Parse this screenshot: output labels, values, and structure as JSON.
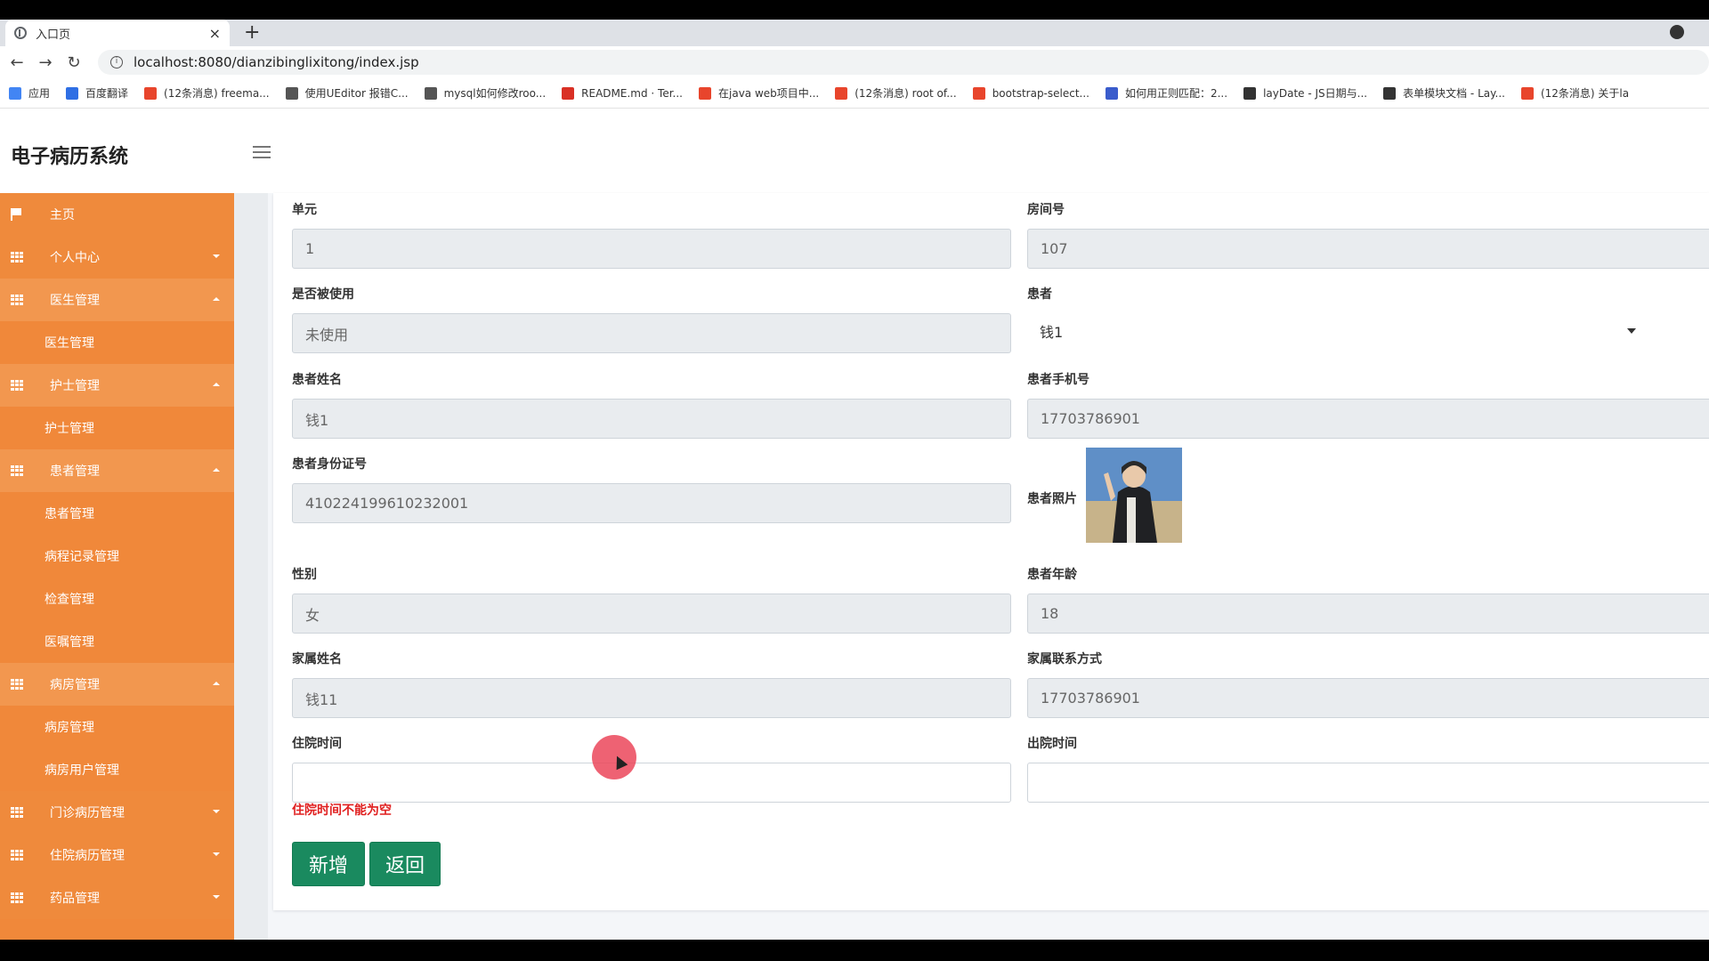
{
  "browser": {
    "tab_title": "入口页",
    "tab_close": "×",
    "new_tab": "+",
    "url": "localhost:8080/dianzibinglixitong/index.jsp",
    "bookmarks": [
      {
        "label": "应用",
        "color": "#4285f4"
      },
      {
        "label": "百度翻译",
        "color": "#2f6fe4"
      },
      {
        "label": "(12条消息) freema...",
        "color": "#e8452c"
      },
      {
        "label": "使用UEditor 报错C...",
        "color": "#555555"
      },
      {
        "label": "mysql如何修改roo...",
        "color": "#555555"
      },
      {
        "label": "README.md · Ter...",
        "color": "#d93025"
      },
      {
        "label": "在java web项目中...",
        "color": "#e8452c"
      },
      {
        "label": "(12条消息) root of...",
        "color": "#e8452c"
      },
      {
        "label": "bootstrap-select...",
        "color": "#e8452c"
      },
      {
        "label": "如何用正则匹配：2...",
        "color": "#3a5ccc"
      },
      {
        "label": "layDate - JS日期与...",
        "color": "#333333"
      },
      {
        "label": "表单模块文档 - Lay...",
        "color": "#333333"
      },
      {
        "label": "(12条消息) 关于la",
        "color": "#e8452c"
      }
    ]
  },
  "app": {
    "brand": "电子病历系统"
  },
  "sidebar": {
    "home": "主页",
    "items": [
      {
        "label": "个人中心",
        "type": "parent",
        "open": false
      },
      {
        "label": "医生管理",
        "type": "parent",
        "open": true
      },
      {
        "label": "医生管理",
        "type": "child"
      },
      {
        "label": "护士管理",
        "type": "parent",
        "open": true
      },
      {
        "label": "护士管理",
        "type": "child"
      },
      {
        "label": "患者管理",
        "type": "parent",
        "open": true
      },
      {
        "label": "患者管理",
        "type": "child"
      },
      {
        "label": "病程记录管理",
        "type": "child"
      },
      {
        "label": "检查管理",
        "type": "child"
      },
      {
        "label": "医嘱管理",
        "type": "child"
      },
      {
        "label": "病房管理",
        "type": "parent",
        "open": true
      },
      {
        "label": "病房管理",
        "type": "child"
      },
      {
        "label": "病房用户管理",
        "type": "child"
      },
      {
        "label": "门诊病历管理",
        "type": "parent",
        "open": false
      },
      {
        "label": "住院病历管理",
        "type": "parent",
        "open": false
      },
      {
        "label": "药品管理",
        "type": "parent",
        "open": false
      }
    ]
  },
  "form": {
    "unit": {
      "label": "单元",
      "value": "1"
    },
    "room": {
      "label": "房间号",
      "value": "107"
    },
    "used": {
      "label": "是否被使用",
      "value": "未使用"
    },
    "patient": {
      "label": "患者",
      "value": "钱1"
    },
    "patient_name": {
      "label": "患者姓名",
      "value": "钱1"
    },
    "patient_phone": {
      "label": "患者手机号",
      "value": "17703786901"
    },
    "patient_id": {
      "label": "患者身份证号",
      "value": "410224199610232001"
    },
    "patient_photo": {
      "label": "患者照片"
    },
    "gender": {
      "label": "性别",
      "value": "女"
    },
    "age": {
      "label": "患者年龄",
      "value": "18"
    },
    "family_name": {
      "label": "家属姓名",
      "value": "钱11"
    },
    "family_contact": {
      "label": "家属联系方式",
      "value": "17703786901"
    },
    "admit_time": {
      "label": "住院时间",
      "value": ""
    },
    "discharge_time": {
      "label": "出院时间",
      "value": ""
    },
    "error": "住院时间不能为空",
    "add_button": "新增",
    "back_button": "返回"
  },
  "colors": {
    "sidebar": "#f0883a",
    "button": "#1a8a5f",
    "error": "#e02020"
  }
}
